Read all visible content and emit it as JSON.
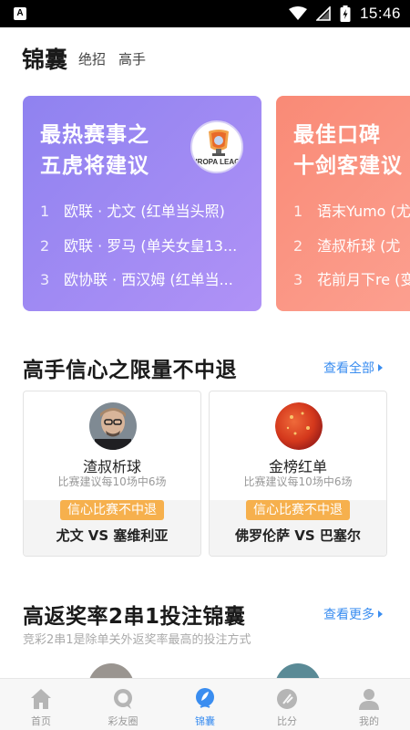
{
  "status_bar": {
    "time": "15:46",
    "app_badge": "A"
  },
  "header": {
    "title": "锦囊",
    "tabs": [
      {
        "label": "绝招"
      },
      {
        "label": "高手"
      }
    ]
  },
  "featured_cards": [
    {
      "title_line1": "最热赛事之",
      "title_line2": "五虎将建议",
      "logo_text": "EUROPA LEAGUE",
      "color": "#a08af4",
      "items": [
        {
          "num": "1",
          "text": "欧联 · 尤文 (红单当头照)"
        },
        {
          "num": "2",
          "text": "欧联 · 罗马 (单关女皇13..."
        },
        {
          "num": "3",
          "text": "欧协联 · 西汉姆 (红单当..."
        }
      ]
    },
    {
      "title_line1": "最佳口碑",
      "title_line2": "十剑客建议",
      "color": "#fa907f",
      "items": [
        {
          "num": "1",
          "text": "语末Yumo (尤"
        },
        {
          "num": "2",
          "text": "渣叔析球 (尤"
        },
        {
          "num": "3",
          "text": "花前月下re (变"
        }
      ]
    }
  ],
  "section1": {
    "title": "高手信心之限量不中退",
    "link": "查看全部",
    "cards": [
      {
        "name": "渣叔析球",
        "desc": "比赛建议每10场中6场",
        "badge": "信心比赛不中退",
        "match": "尤文 VS 塞维利亚"
      },
      {
        "name": "金榜红单",
        "desc": "比赛建议每10场中6场",
        "badge": "信心比赛不中退",
        "match": "佛罗伦萨 VS 巴塞尔"
      }
    ]
  },
  "section2": {
    "title": "高返奖率2串1投注锦囊",
    "link": "查看更多",
    "subtitle": "竞彩2串1是除单关外返奖率最高的投注方式"
  },
  "bottom_nav": [
    {
      "label": "首页",
      "icon": "home-icon",
      "active": false
    },
    {
      "label": "彩友圈",
      "icon": "chat-bubble-icon",
      "active": false
    },
    {
      "label": "锦囊",
      "icon": "feather-icon",
      "active": true
    },
    {
      "label": "比分",
      "icon": "soccer-ball-icon",
      "active": false
    },
    {
      "label": "我的",
      "icon": "person-icon",
      "active": false
    }
  ],
  "colors": {
    "accent": "#3a8df0",
    "badge": "#f6b04d",
    "card_purple": "#a08af4",
    "card_salmon": "#fa907f"
  }
}
